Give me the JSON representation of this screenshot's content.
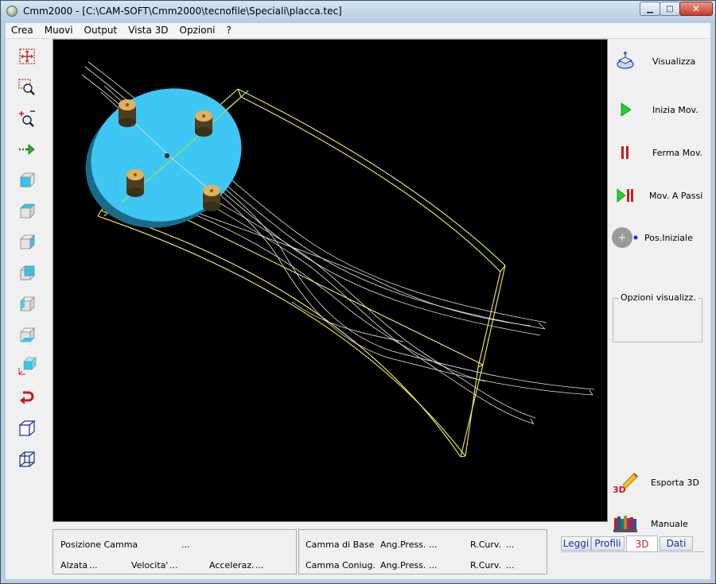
{
  "window": {
    "title": "Cmm2000 - [C:\\CAM-SOFT\\Cmm2000\\tecnofile\\Speciali\\placca.tec]"
  },
  "caption_buttons": {
    "minimize": "▁",
    "maximize": "□",
    "close": "✕"
  },
  "menu": [
    "Crea",
    "Muovi",
    "Output",
    "Vista 3D",
    "Opzioni",
    "?"
  ],
  "toolbar": [
    {
      "name": "fit-view-icon"
    },
    {
      "name": "zoom-window-icon"
    },
    {
      "name": "zoom-in-out-icon"
    },
    {
      "name": "pan-arrow-icon"
    },
    {
      "name": "view-front-icon"
    },
    {
      "name": "view-top-icon"
    },
    {
      "name": "view-right-icon"
    },
    {
      "name": "view-back-icon"
    },
    {
      "name": "view-left-icon"
    },
    {
      "name": "view-bottom-icon"
    },
    {
      "name": "view-isometric-icon"
    },
    {
      "name": "rotate-view-icon"
    },
    {
      "name": "solid-mode-icon"
    },
    {
      "name": "wireframe-mode-icon"
    }
  ],
  "right_panel": {
    "visualizza": "Visualizza",
    "inizia": "Inizia Mov.",
    "ferma": "Ferma Mov.",
    "passi": "Mov. A Passi",
    "posizione": "Pos.Iniziale",
    "opzioni_title": "Opzioni visualizz.",
    "esporta": "Esporta 3D",
    "manuale": "Manuale",
    "esporta_icon_text": "3D"
  },
  "status": {
    "posizione_label": "Posizione Camma",
    "posizione_value": "...",
    "alzata_label": "Alzata",
    "alzata_value": "...",
    "velocita_label": "Velocita'",
    "velocita_value": "...",
    "acceleraz_label": "Acceleraz.",
    "acceleraz_value": "...",
    "base_label": "Camma di Base",
    "base_ang_label": "Ang.Press.",
    "base_ang_value": "...",
    "base_rcurv_label": "R.Curv.",
    "base_rcurv_value": "...",
    "coniug_label": "Camma Coniug.",
    "coniug_ang_label": "Ang.Press.",
    "coniug_ang_value": "...",
    "coniug_rcurv_label": "R.Curv.",
    "coniug_rcurv_value": "..."
  },
  "tabs": [
    "Leggi",
    "Profili",
    "3D",
    "Dati"
  ],
  "active_tab": "3D",
  "colors": {
    "viewport_bg": "#000000",
    "disk": "#3ec7f4",
    "frame": "#f2f25a",
    "tracks": "#e8e8e8",
    "pins": "#e2b15c"
  }
}
